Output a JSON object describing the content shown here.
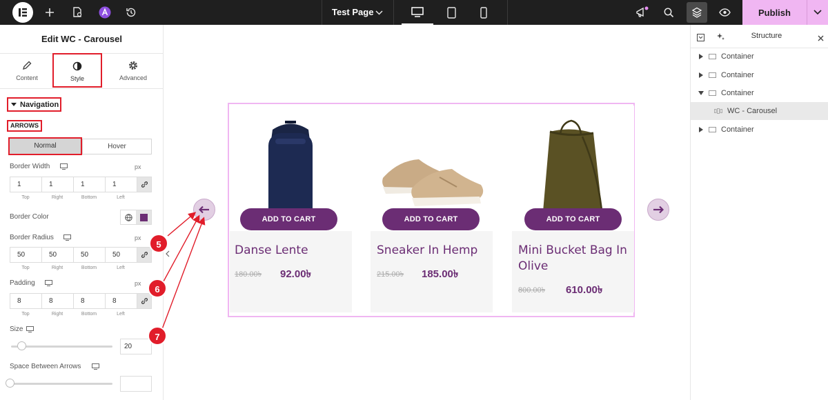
{
  "topbar": {
    "page_name": "Test Page",
    "publish_label": "Publish",
    "colors": {
      "bg": "#1f1f1f",
      "publish_bg": "#f0b6f2"
    }
  },
  "panel": {
    "title": "Edit WC - Carousel",
    "tabs": [
      {
        "label": "Content",
        "icon": "pencil-icon"
      },
      {
        "label": "Style",
        "icon": "half-circle-icon"
      },
      {
        "label": "Advanced",
        "icon": "gear-icon"
      }
    ],
    "section_title": "Navigation",
    "subsection": "ARROWS",
    "state_tabs": [
      "Normal",
      "Hover"
    ],
    "border_width": {
      "label": "Border Width",
      "unit": "px",
      "values": [
        "1",
        "1",
        "1",
        "1"
      ]
    },
    "border_color": {
      "label": "Border Color",
      "swatch": "#6b2d74"
    },
    "border_radius": {
      "label": "Border Radius",
      "unit": "px",
      "values": [
        "50",
        "50",
        "50",
        "50"
      ]
    },
    "padding": {
      "label": "Padding",
      "unit": "px",
      "values": [
        "8",
        "8",
        "8",
        "8"
      ]
    },
    "side_labels": [
      "Top",
      "Right",
      "Bottom",
      "Left"
    ],
    "size": {
      "label": "Size",
      "value": "20"
    },
    "space_between": {
      "label": "Space Between Arrows",
      "value": ""
    }
  },
  "products": [
    {
      "name": "Danse Lente",
      "old_price": "180.00৳",
      "price": "92.00৳",
      "button": "ADD TO CART"
    },
    {
      "name": "Sneaker In Hemp",
      "old_price": "215.00৳",
      "price": "185.00৳",
      "button": "ADD TO CART"
    },
    {
      "name": "Mini Bucket Bag In Olive",
      "name_line1": "Mini Bucket Bag In",
      "name_line2": "Olive",
      "old_price": "800.00৳",
      "price": "610.00৳",
      "button": "ADD TO CART"
    }
  ],
  "callouts": [
    "5",
    "6",
    "7"
  ],
  "structure": {
    "title": "Structure",
    "items": [
      {
        "label": "Container"
      },
      {
        "label": "Container"
      },
      {
        "label": "Container"
      },
      {
        "label": "WC - Carousel"
      },
      {
        "label": "Container"
      }
    ]
  },
  "accent": "#6b2d74"
}
